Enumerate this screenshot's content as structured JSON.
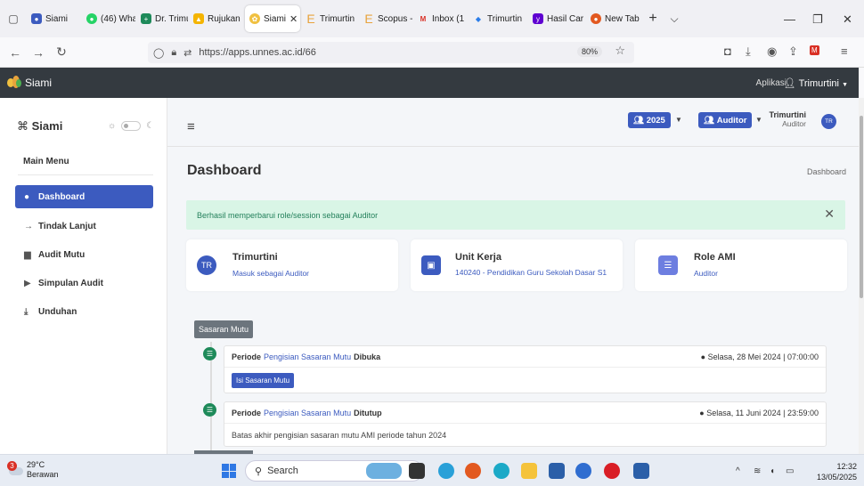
{
  "browser": {
    "tabs": [
      {
        "label": "Siami",
        "icon": "person-icon",
        "color": "#3c5bbf",
        "active": false
      },
      {
        "label": "(46) Wha",
        "icon": "whatsapp-icon",
        "color": "#25d366",
        "active": false
      },
      {
        "label": "Dr. Trimu",
        "icon": "plus-cross-icon",
        "color": "#1e8a5a",
        "active": false
      },
      {
        "label": "Rujukan",
        "icon": "drive-icon",
        "color": "#f4b400",
        "active": false
      },
      {
        "label": "Siami",
        "icon": "siami-logo-icon",
        "color": "#f0c040",
        "active": true
      },
      {
        "label": "Trimurtin",
        "icon": "letter-e-icon",
        "color": "#e8a33c",
        "active": false
      },
      {
        "label": "Scopus -",
        "icon": "letter-e-icon",
        "color": "#e8a33c",
        "active": false
      },
      {
        "label": "Inbox (1",
        "icon": "gmail-icon",
        "color": "#d93025",
        "active": false
      },
      {
        "label": "Trimurtin",
        "icon": "diamond-icon",
        "color": "#2b7de9",
        "active": false
      },
      {
        "label": "Hasil Car",
        "icon": "yahoo-icon",
        "color": "#5f01d1",
        "active": false
      },
      {
        "label": "New Tab",
        "icon": "firefox-icon",
        "color": "#e25920",
        "active": false
      }
    ],
    "close_tab_glyph": "✕",
    "url": "https://apps.unnes.ac.id/66",
    "zoom": "80%"
  },
  "app": {
    "brand": "Siami",
    "menu_aplikasi": "Aplikasi",
    "user_menu": "Trimurtini"
  },
  "sidebar": {
    "brand": "Siami",
    "section": "Main Menu",
    "items": [
      {
        "label": "Dashboard",
        "icon": "palette-icon"
      },
      {
        "label": "Tindak Lanjut",
        "icon": "arrow-right-icon"
      },
      {
        "label": "Audit Mutu",
        "icon": "file-icon"
      },
      {
        "label": "Simpulan Audit",
        "icon": "chart-icon"
      },
      {
        "label": "Unduhan",
        "icon": "download-icon"
      }
    ]
  },
  "topbar": {
    "year": "2025",
    "role": "Auditor",
    "user_name": "Trimurtini",
    "user_role": "Auditor",
    "avatar": "TR"
  },
  "page": {
    "title": "Dashboard",
    "breadcrumb": "Dashboard",
    "alert": "Berhasil memperbarui role/session sebagai Auditor",
    "close": "✕"
  },
  "cards": [
    {
      "title": "Trimurtini",
      "sub": "Masuk sebagai Auditor",
      "icon_text": "TR"
    },
    {
      "title": "Unit Kerja",
      "sub": "140240 - Pendidikan Guru Sekolah Dasar S1",
      "icon_text": "▣"
    },
    {
      "title": "Role AMI",
      "sub": "Auditor",
      "icon_text": "☰"
    }
  ],
  "timeline": {
    "label": "Sasaran Mutu",
    "events": [
      {
        "prefix": "Periode",
        "link": "Pengisian Sasaran Mutu",
        "suffix": "Dibuka",
        "time": "Selasa, 28 Mei 2024 | 07:00:00",
        "button": "Isi Sasaran Mutu"
      },
      {
        "prefix": "Periode",
        "link": "Pengisian Sasaran Mutu",
        "suffix": "Ditutup",
        "time": "Selasa, 11 Juni 2024 | 23:59:00",
        "body": "Batas akhir pengisian sasaran mutu AMI periode tahun 2024"
      }
    ]
  },
  "taskbar": {
    "temp": "29°C",
    "weather": "Berawan",
    "badge": "3",
    "search": "Search",
    "time": "12:32",
    "date": "13/05/2025"
  }
}
